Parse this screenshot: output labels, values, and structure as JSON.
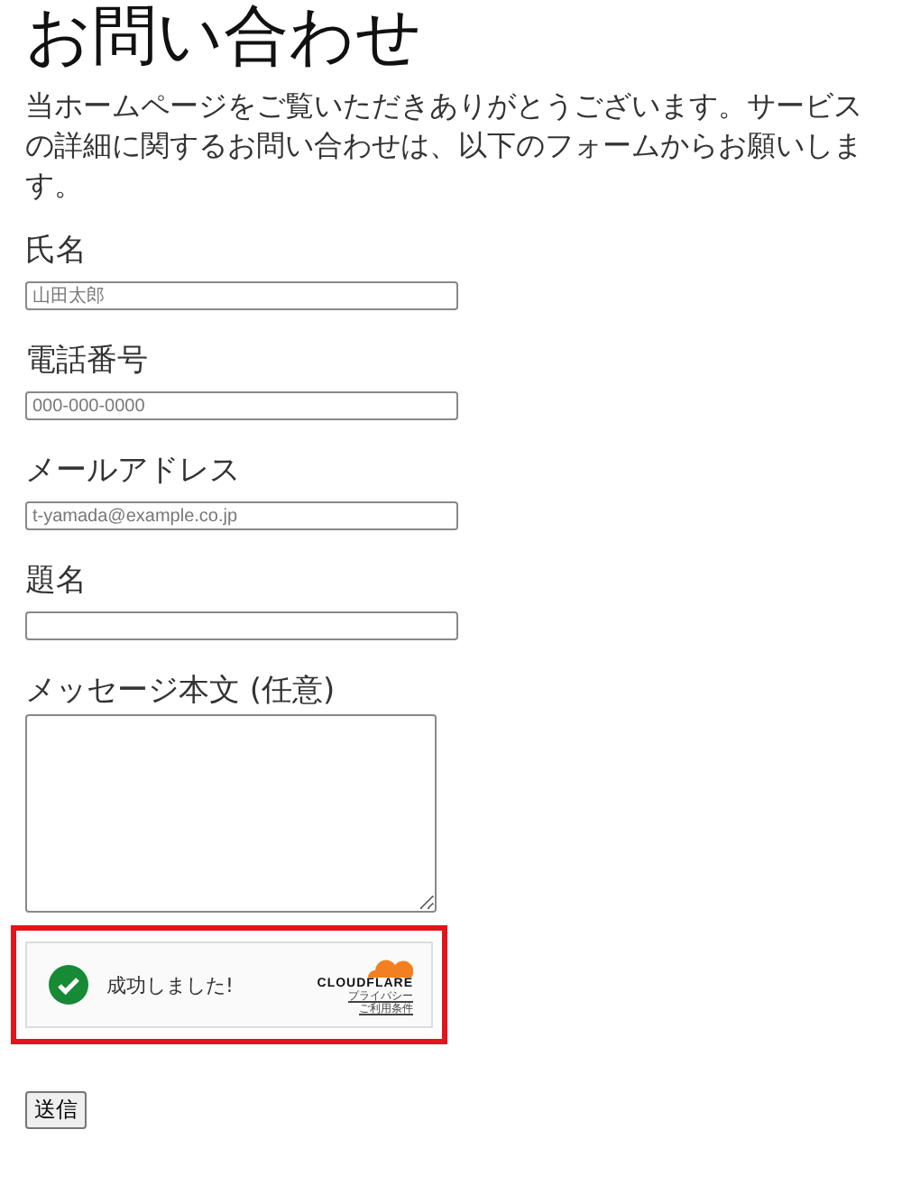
{
  "title": "お問い合わせ",
  "intro": "当ホームページをご覧いただきありがとうございます。サービスの詳細に関するお問い合わせは、以下のフォームからお願いします。",
  "fields": [
    {
      "kind": "input",
      "label": "氏名",
      "placeholder": "山田太郎"
    },
    {
      "kind": "input",
      "label": "電話番号",
      "placeholder": "000-000-0000"
    },
    {
      "kind": "input",
      "label": "メールアドレス",
      "placeholder": "t-yamada@example.co.jp"
    },
    {
      "kind": "input",
      "label": "題名"
    },
    {
      "kind": "textarea",
      "label": "メッセージ本文 (任意)"
    }
  ],
  "captcha": {
    "success": true,
    "status": "成功しました!",
    "brand": "CLOUDFLARE",
    "links": [
      "プライバシー",
      "ご利用条件"
    ],
    "highlighted": true
  },
  "submit": "送信"
}
